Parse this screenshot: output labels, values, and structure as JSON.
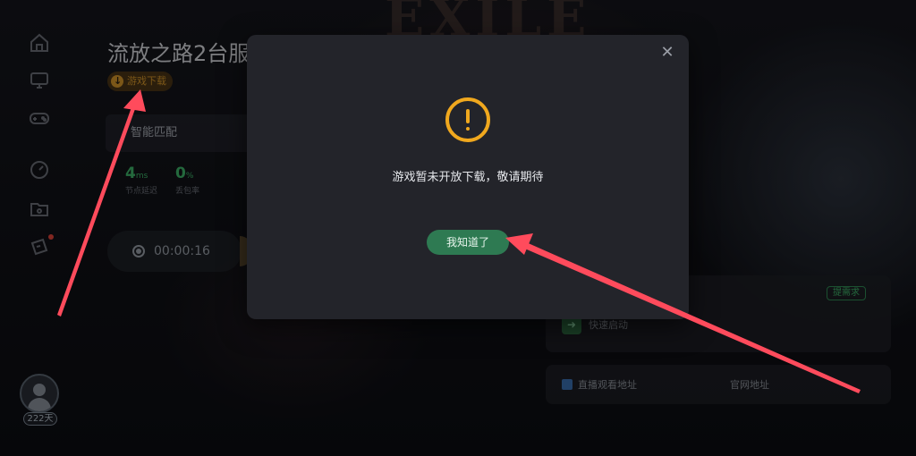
{
  "game": {
    "title": "流放之路2台服",
    "download_tag": "游戏下载",
    "background_title": "EXILE"
  },
  "sidebar": {
    "icons": [
      "home-icon",
      "monitor-icon",
      "gamepad-icon",
      "speed-gauge-icon",
      "folder-icon",
      "ticket-icon"
    ],
    "notification_dot_color": "#e0443a",
    "member_days": "222天"
  },
  "acceleration": {
    "mode_label": "智能匹配",
    "latency": {
      "value": "4",
      "unit": "ms",
      "label": "节点延迟"
    },
    "loss": {
      "value": "0",
      "unit": "%",
      "label": "丢包率"
    },
    "timer": "00:00:16"
  },
  "right_panel": {
    "demand_tag": "提需求",
    "quick_launch": "快速启动",
    "live_link": "直播观看地址",
    "official_site": "官网地址"
  },
  "modal": {
    "message": "游戏暂未开放下载，敬请期待",
    "confirm_label": "我知道了",
    "close_symbol": "✕"
  },
  "colors": {
    "accent_green": "#2e7a52",
    "warning_orange": "#f0a81e",
    "status_green": "#3fb56a",
    "annotation_arrow": "#ff4b5c"
  }
}
